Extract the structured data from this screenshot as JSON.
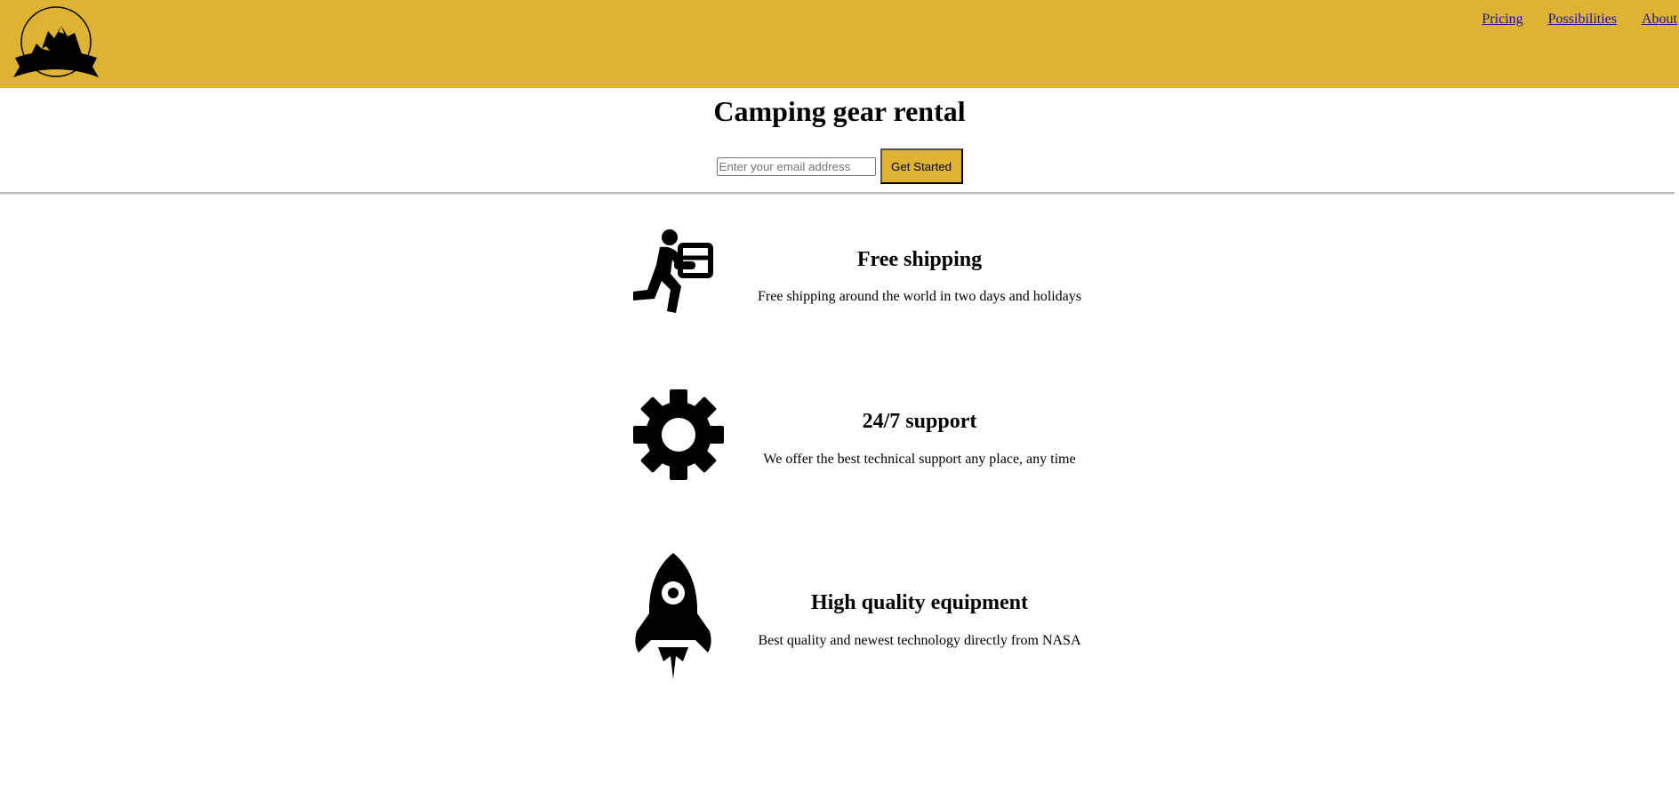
{
  "header": {
    "background_color": "#dfb332",
    "logo_icon": "mountain-logo-icon",
    "nav": [
      {
        "label": "Pricing"
      },
      {
        "label": "Possibilities"
      },
      {
        "label": "About"
      }
    ]
  },
  "hero": {
    "title": "Camping gear rental",
    "email_placeholder": "Enter your email address",
    "submit_label": "Get Started"
  },
  "features": [
    {
      "icon": "delivery-person-icon",
      "title": "Free shipping",
      "description": "Free shipping around the world in two days and holidays"
    },
    {
      "icon": "gear-icon",
      "title": "24/7 support",
      "description": "We offer the best technical support any place, any time"
    },
    {
      "icon": "rocket-icon",
      "title": "High quality equipment",
      "description": "Best quality and newest technology directly from NASA"
    }
  ]
}
